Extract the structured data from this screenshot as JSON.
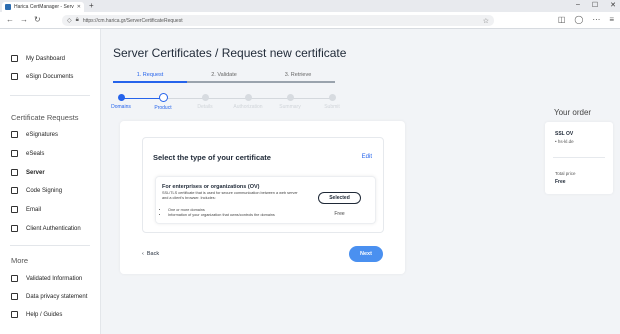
{
  "browser": {
    "tab_title": "Harica CertManager - Server Ce",
    "tab_close": "✕",
    "new_tab": "+",
    "window_controls": [
      "–",
      "☐",
      "✕"
    ],
    "url": "https://cm.harica.gr/ServerCertificateRequest"
  },
  "sidebar": {
    "top_items": [
      {
        "label": "My Dashboard",
        "icon": "dashboard-icon"
      },
      {
        "label": "eSign Documents",
        "icon": "document-icon"
      }
    ],
    "section_requests": "Certificate Requests",
    "request_items": [
      {
        "label": "eSignatures",
        "icon": "pen-icon"
      },
      {
        "label": "eSeals",
        "icon": "seal-icon"
      },
      {
        "label": "Server",
        "icon": "server-icon",
        "active": true
      },
      {
        "label": "Code Signing",
        "icon": "code-icon"
      },
      {
        "label": "Email",
        "icon": "mail-icon"
      },
      {
        "label": "Client Authentication",
        "icon": "client-icon"
      }
    ],
    "section_more": "More",
    "more_items": [
      {
        "label": "Validated Information",
        "icon": "anchor-icon"
      },
      {
        "label": "Data privacy statement",
        "icon": "privacy-icon"
      },
      {
        "label": "Help / Guides",
        "icon": "help-icon"
      }
    ]
  },
  "main": {
    "title": "Server Certificates / Request new certificate",
    "steps": [
      {
        "label": "1. Request",
        "active": true
      },
      {
        "label": "2. Validate",
        "active": false
      },
      {
        "label": "3. Retrieve",
        "active": false
      }
    ],
    "progress": [
      {
        "label": "Domains",
        "state": "done"
      },
      {
        "label": "Product",
        "state": "current"
      },
      {
        "label": "Details",
        "state": "todo"
      },
      {
        "label": "Authorization",
        "state": "todo"
      },
      {
        "label": "Summary",
        "state": "todo"
      },
      {
        "label": "Submit",
        "state": "todo"
      }
    ],
    "section_title": "Select the type of your certificate",
    "edit_label": "Edit",
    "option": {
      "title": "For enterprises or organizations (OV)",
      "description": "SSL/TLS certificate that is used for secure communication between a web server and a client's browser. Includes:",
      "bullets": [
        "One or more domains",
        "Information of your organization that owns/controls the domains"
      ],
      "selected_label": "Selected",
      "price": "Free"
    },
    "back_label": "Back",
    "next_label": "Next"
  },
  "order": {
    "heading": "Your order",
    "product": "SSL OV",
    "product_detail": "• hs-kl.de",
    "total_label": "Total price",
    "total_value": "Free"
  },
  "colors": {
    "accent": "#2563eb",
    "next_button": "#4a90f0",
    "background": "#f2f4f7"
  }
}
